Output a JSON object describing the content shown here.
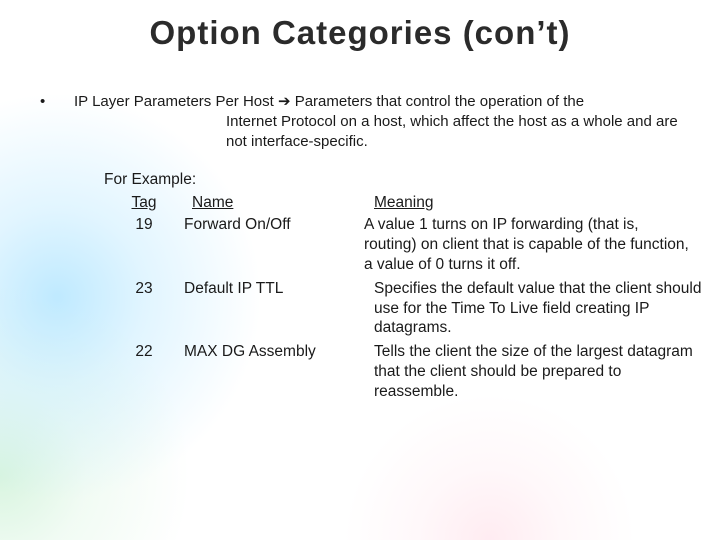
{
  "title": "Option Categories (con’t)",
  "bullet": {
    "mark": "•",
    "lead": "IP Layer Parameters Per Host ➔ Parameters that control the operation of the",
    "cont": "Internet Protocol on a host, which affect the host as a whole and are not interface-specific."
  },
  "example": {
    "label": "For Example:",
    "headers": {
      "tag": "Tag",
      "name": "Name",
      "meaning": "Meaning"
    },
    "rows": [
      {
        "tag": "19",
        "name": "Forward On/Off",
        "meaning": "A value 1 turns on IP forwarding (that is, routing) on client that is capable of the function, a value of 0 turns it off."
      },
      {
        "tag": "23",
        "name": "Default IP TTL",
        "meaning": "Specifies the default value that the client should use for the Time To Live field creating IP datagrams."
      },
      {
        "tag": "22",
        "name": "MAX DG Assembly",
        "meaning": "Tells the client the size of the largest datagram that the client should be prepared to reassemble."
      }
    ]
  }
}
